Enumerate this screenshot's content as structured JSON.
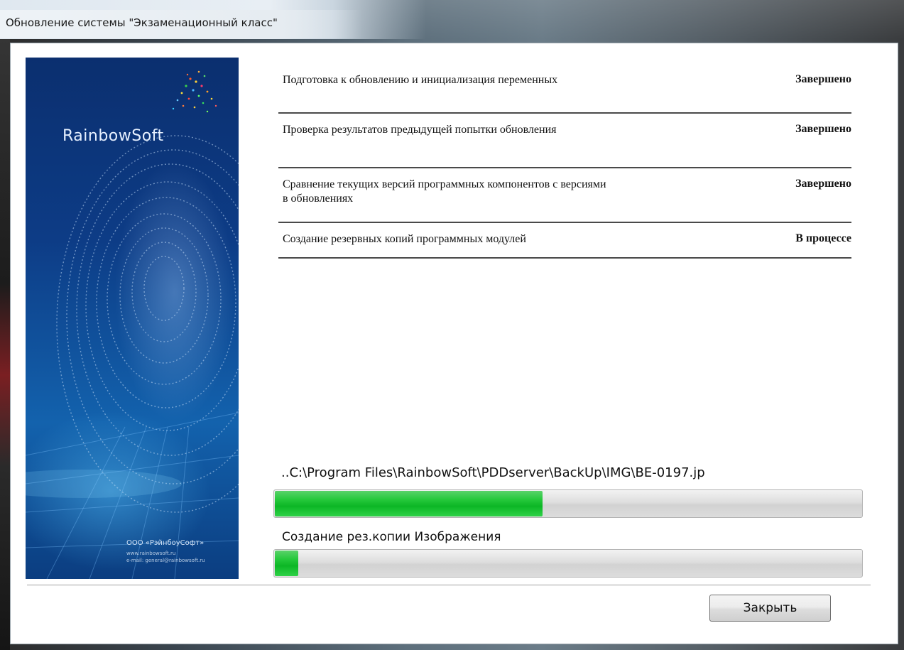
{
  "window": {
    "title": "Обновление системы \"Экзаменационный класс\""
  },
  "banner": {
    "logo_text": "RainbowSoft",
    "company": "ООО «РэйнбоуСофт»",
    "website": "www.rainbowsoft.ru",
    "email": "e-mail: general@rainbowsoft.ru"
  },
  "tasks": [
    {
      "label": "Подготовка к обновлению и инициализация переменных",
      "status": "Завершено"
    },
    {
      "label": "Проверка результатов предыдущей попытки обновления",
      "status": "Завершено"
    },
    {
      "label": "Сравнение текущих версий программных компонентов с версиями в обновлениях",
      "status": "Завершено"
    },
    {
      "label": "Создание резервных копий программных модулей",
      "status": "В процессе"
    }
  ],
  "current_file": "..C:\\Program Files\\RainbowSoft\\PDDserver\\BackUp\\IMG\\BE-0197.jp",
  "overall_progress": 0.455,
  "stage_label": "Создание рез.копии Изображения",
  "stage_progress": 0.04,
  "close_button_label": "Закрыть",
  "colors": {
    "progress_green": "#0cb625",
    "banner_blue": "#0d3c86"
  }
}
